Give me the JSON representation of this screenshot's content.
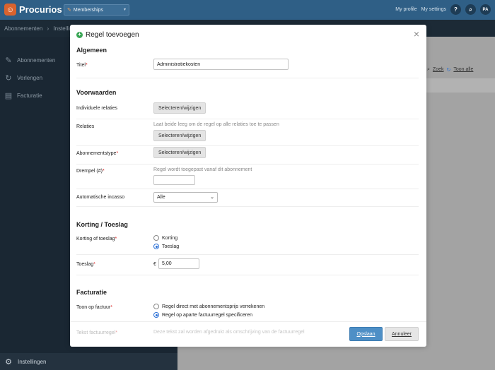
{
  "app": {
    "logo_text": "Procurios",
    "module": "Memberships",
    "my_profile": "My profile",
    "my_settings": "My settings",
    "help_label": "?",
    "avatar_initials": "PA"
  },
  "breadcrumb": {
    "root": "Abonnementen",
    "sep": "›",
    "current": "Instellin"
  },
  "sidebar": {
    "items": [
      {
        "label": "Abonnementen",
        "icon": "edit-icon"
      },
      {
        "label": "Verlengen",
        "icon": "refresh-icon"
      },
      {
        "label": "Facturatie",
        "icon": "document-icon"
      }
    ],
    "bottom_label": "Instellingen"
  },
  "background": {
    "search_label": "Zoek",
    "show_all_label": "Toon alle"
  },
  "modal": {
    "title": "Regel toevoegen",
    "sections": {
      "general": "Algemeen",
      "conditions": "Voorwaarden",
      "discount": "Korting / Toeslag",
      "invoicing": "Facturatie"
    },
    "fields": {
      "title_label": "Titel",
      "title_value": "Administratiekosten",
      "individual_relations_label": "Individuele relaties",
      "select_button": "Selecteren/wijzigen",
      "relations_label": "Relaties",
      "relations_hint": "Laat beide leeg om de regel op alle relaties toe te passen",
      "subscription_type_label": "Abonnementstype",
      "threshold_label": "Drempel (#)",
      "threshold_hint": "Regel wordt toegepast vanaf dit abonnement",
      "threshold_value": "",
      "direct_debit_label": "Automatische incasso",
      "direct_debit_value": "Alle",
      "discount_or_surcharge_label": "Korting of toeslag",
      "option_discount": "Korting",
      "option_surcharge": "Toeslag",
      "selected_option": "Toeslag",
      "surcharge_label": "Toeslag",
      "currency_symbol": "€",
      "surcharge_value": "5,00",
      "show_on_invoice_label": "Toon op factuur",
      "invoice_option_1": "Regel direct met abonnementsprijs verrekenen",
      "invoice_option_2": "Regel op aparte factuurregel specificeren",
      "invoice_selected": "Regel op aparte factuurregel specificeren",
      "invoice_line_text_label": "Tekst factuurregel",
      "invoice_line_text_hint": "Deze tekst zal worden afgedrukt als omschrijving van de factuurregel"
    },
    "buttons": {
      "save": "Opslaan",
      "cancel": "Annuleer"
    }
  },
  "colors": {
    "topbar": "#2f5f86",
    "sidebar": "#1a2733",
    "primary_button": "#4e8fc6",
    "required": "#dd2222",
    "add_icon": "#3aa655"
  }
}
